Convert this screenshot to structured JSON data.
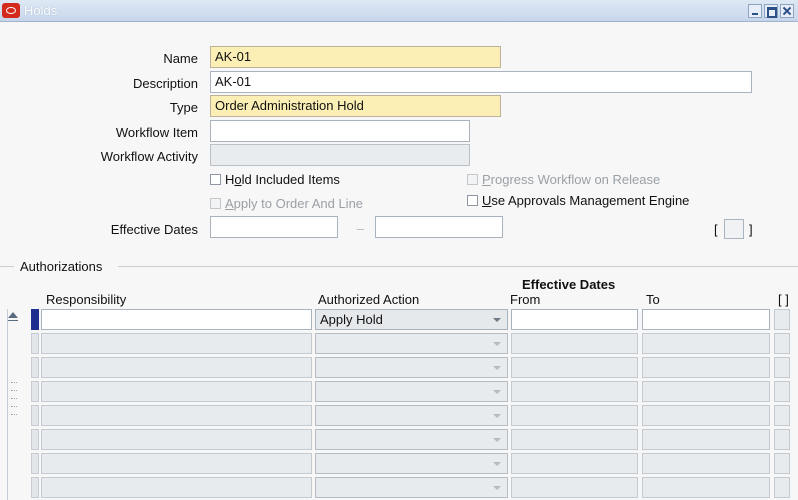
{
  "window": {
    "title": "Holds"
  },
  "form": {
    "name_label": "Name",
    "name_value": "AK-01",
    "description_label": "Description",
    "description_value": "AK-01",
    "type_label": "Type",
    "type_value": "Order Administration Hold",
    "workflow_item_label": "Workflow Item",
    "workflow_item_value": "",
    "workflow_activity_label": "Workflow Activity",
    "workflow_activity_value": "",
    "hold_included_items": {
      "label_pre": "H",
      "label_ul": "o",
      "label_post": "ld Included Items",
      "checked": false
    },
    "progress_workflow": {
      "label_pre": "",
      "label_ul": "P",
      "label_post": "rogress Workflow on Release",
      "checked": false
    },
    "apply_order_line": {
      "label_pre": "",
      "label_ul": "A",
      "label_post": "pply to Order And Line",
      "checked": false
    },
    "use_approvals": {
      "label_pre": "",
      "label_ul": "U",
      "label_post": "se Approvals Management Engine",
      "checked": false
    },
    "effective_dates_label": "Effective Dates",
    "effective_from": "",
    "effective_to": "",
    "dash": "–",
    "bracket_open": "[",
    "bracket_close": "]"
  },
  "authorizations": {
    "section_title": "Authorizations",
    "group_header": "Effective Dates",
    "columns": {
      "responsibility": "Responsibility",
      "authorized_action": "Authorized Action",
      "from": "From",
      "to": "To",
      "flex": "[ ]"
    },
    "rows": [
      {
        "responsibility": "",
        "action": "Apply Hold",
        "from": "",
        "to": ""
      },
      {
        "responsibility": "",
        "action": "",
        "from": "",
        "to": ""
      },
      {
        "responsibility": "",
        "action": "",
        "from": "",
        "to": ""
      },
      {
        "responsibility": "",
        "action": "",
        "from": "",
        "to": ""
      },
      {
        "responsibility": "",
        "action": "",
        "from": "",
        "to": ""
      },
      {
        "responsibility": "",
        "action": "",
        "from": "",
        "to": ""
      },
      {
        "responsibility": "",
        "action": "",
        "from": "",
        "to": ""
      },
      {
        "responsibility": "",
        "action": "",
        "from": "",
        "to": ""
      }
    ]
  }
}
